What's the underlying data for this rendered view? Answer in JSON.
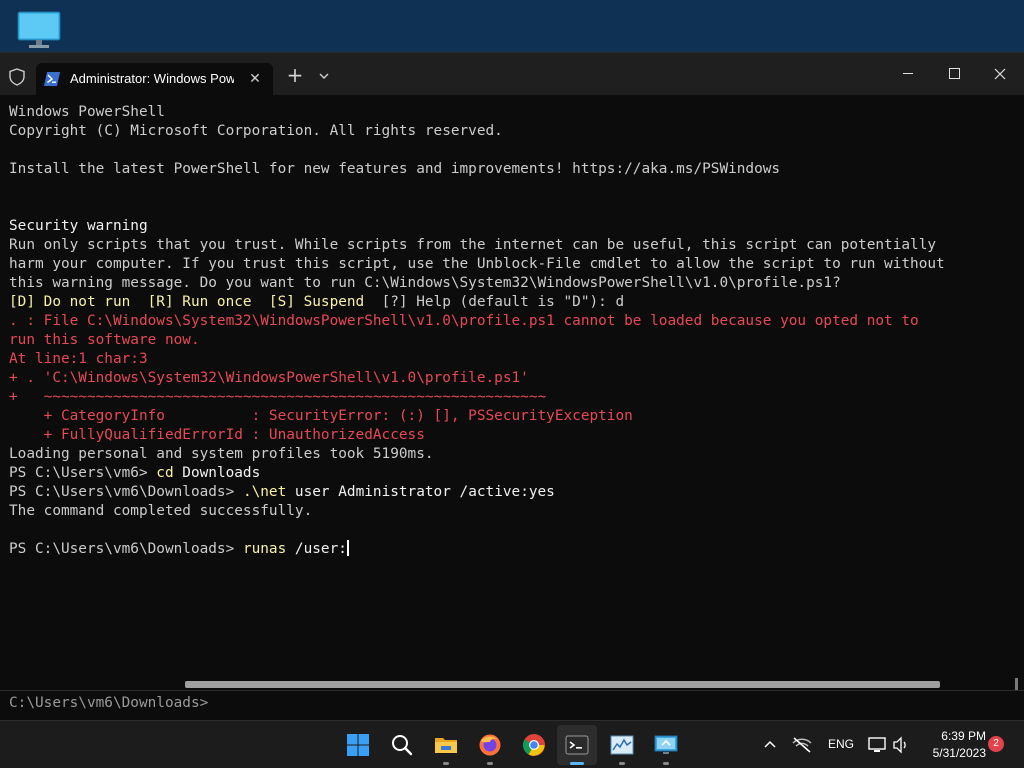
{
  "desktop": {
    "icon": "monitor-icon"
  },
  "window": {
    "tab": {
      "title": "Administrator: Windows PowerShell",
      "icon": "powershell-icon"
    },
    "controls": {
      "minimize": "minimize-icon",
      "maximize": "maximize-icon",
      "close": "close-icon"
    }
  },
  "terminal": {
    "lines": [
      {
        "text": "Windows PowerShell",
        "style": ""
      },
      {
        "text": "Copyright (C) Microsoft Corporation. All rights reserved.",
        "style": ""
      },
      {
        "text": "",
        "style": ""
      },
      {
        "text": "Install the latest PowerShell for new features and improvements! https://aka.ms/PSWindows",
        "style": ""
      },
      {
        "text": "",
        "style": ""
      },
      {
        "text": "",
        "style": ""
      },
      {
        "text": "Security warning",
        "style": "white"
      },
      {
        "text": "Run only scripts that you trust. While scripts from the internet can be useful, this script can potentially",
        "style": ""
      },
      {
        "text": "harm your computer. If you trust this script, use the Unblock-File cmdlet to allow the script to run without",
        "style": ""
      },
      {
        "text": "this warning message. Do you want to run C:\\Windows\\System32\\WindowsPowerShell\\v1.0\\profile.ps1?",
        "style": ""
      },
      {
        "text": "[D] Do not run  [R] Run once  [S] Suspend  ",
        "style": "yellow",
        "rest": "[?] Help (default is \"D\"): d"
      },
      {
        "text": ". : File C:\\Windows\\System32\\WindowsPowerShell\\v1.0\\profile.ps1 cannot be loaded because you opted not to",
        "style": "red"
      },
      {
        "text": "run this software now.",
        "style": "red"
      },
      {
        "text": "At line:1 char:3",
        "style": "red"
      },
      {
        "text": "+ . 'C:\\Windows\\System32\\WindowsPowerShell\\v1.0\\profile.ps1'",
        "style": "red"
      },
      {
        "text": "+   ~~~~~~~~~~~~~~~~~~~~~~~~~~~~~~~~~~~~~~~~~~~~~~~~~~~~~~~~~~",
        "style": "red"
      },
      {
        "text": "    + CategoryInfo          : SecurityError: (:) [], PSSecurityException",
        "style": "red"
      },
      {
        "text": "    + FullyQualifiedErrorId : UnauthorizedAccess",
        "style": "red"
      },
      {
        "text": "Loading personal and system profiles took 5190ms.",
        "style": ""
      },
      {
        "text": "PS C:\\Users\\vm6> ",
        "style": "",
        "cmd": "cd",
        "arg": " Downloads"
      },
      {
        "text": "PS C:\\Users\\vm6\\Downloads> ",
        "style": "",
        "cmd": ".\\net",
        "arg": " user Administrator /active:yes"
      },
      {
        "text": "The command completed successfully.",
        "style": ""
      },
      {
        "text": "",
        "style": ""
      },
      {
        "text": "PS C:\\Users\\vm6\\Downloads> ",
        "style": "",
        "cmd": "runas",
        "arg": " /user:",
        "cursor": true
      }
    ]
  },
  "suggestion": {
    "text": "C:\\Users\\vm6\\Downloads>"
  },
  "taskbar": {
    "apps": [
      {
        "name": "start-button",
        "icon": "windows-logo-icon"
      },
      {
        "name": "search-button",
        "icon": "search-icon"
      },
      {
        "name": "file-explorer-button",
        "icon": "folder-icon"
      },
      {
        "name": "firefox-button",
        "icon": "firefox-icon"
      },
      {
        "name": "chrome-button",
        "icon": "chrome-icon"
      },
      {
        "name": "terminal-button",
        "icon": "terminal-icon"
      },
      {
        "name": "task-manager-button",
        "icon": "chart-icon"
      },
      {
        "name": "remote-desktop-button",
        "icon": "remote-desktop-icon"
      }
    ],
    "tray": {
      "language": "ENG",
      "time": "6:39 PM",
      "date": "5/31/2023",
      "notifications": "2"
    }
  }
}
